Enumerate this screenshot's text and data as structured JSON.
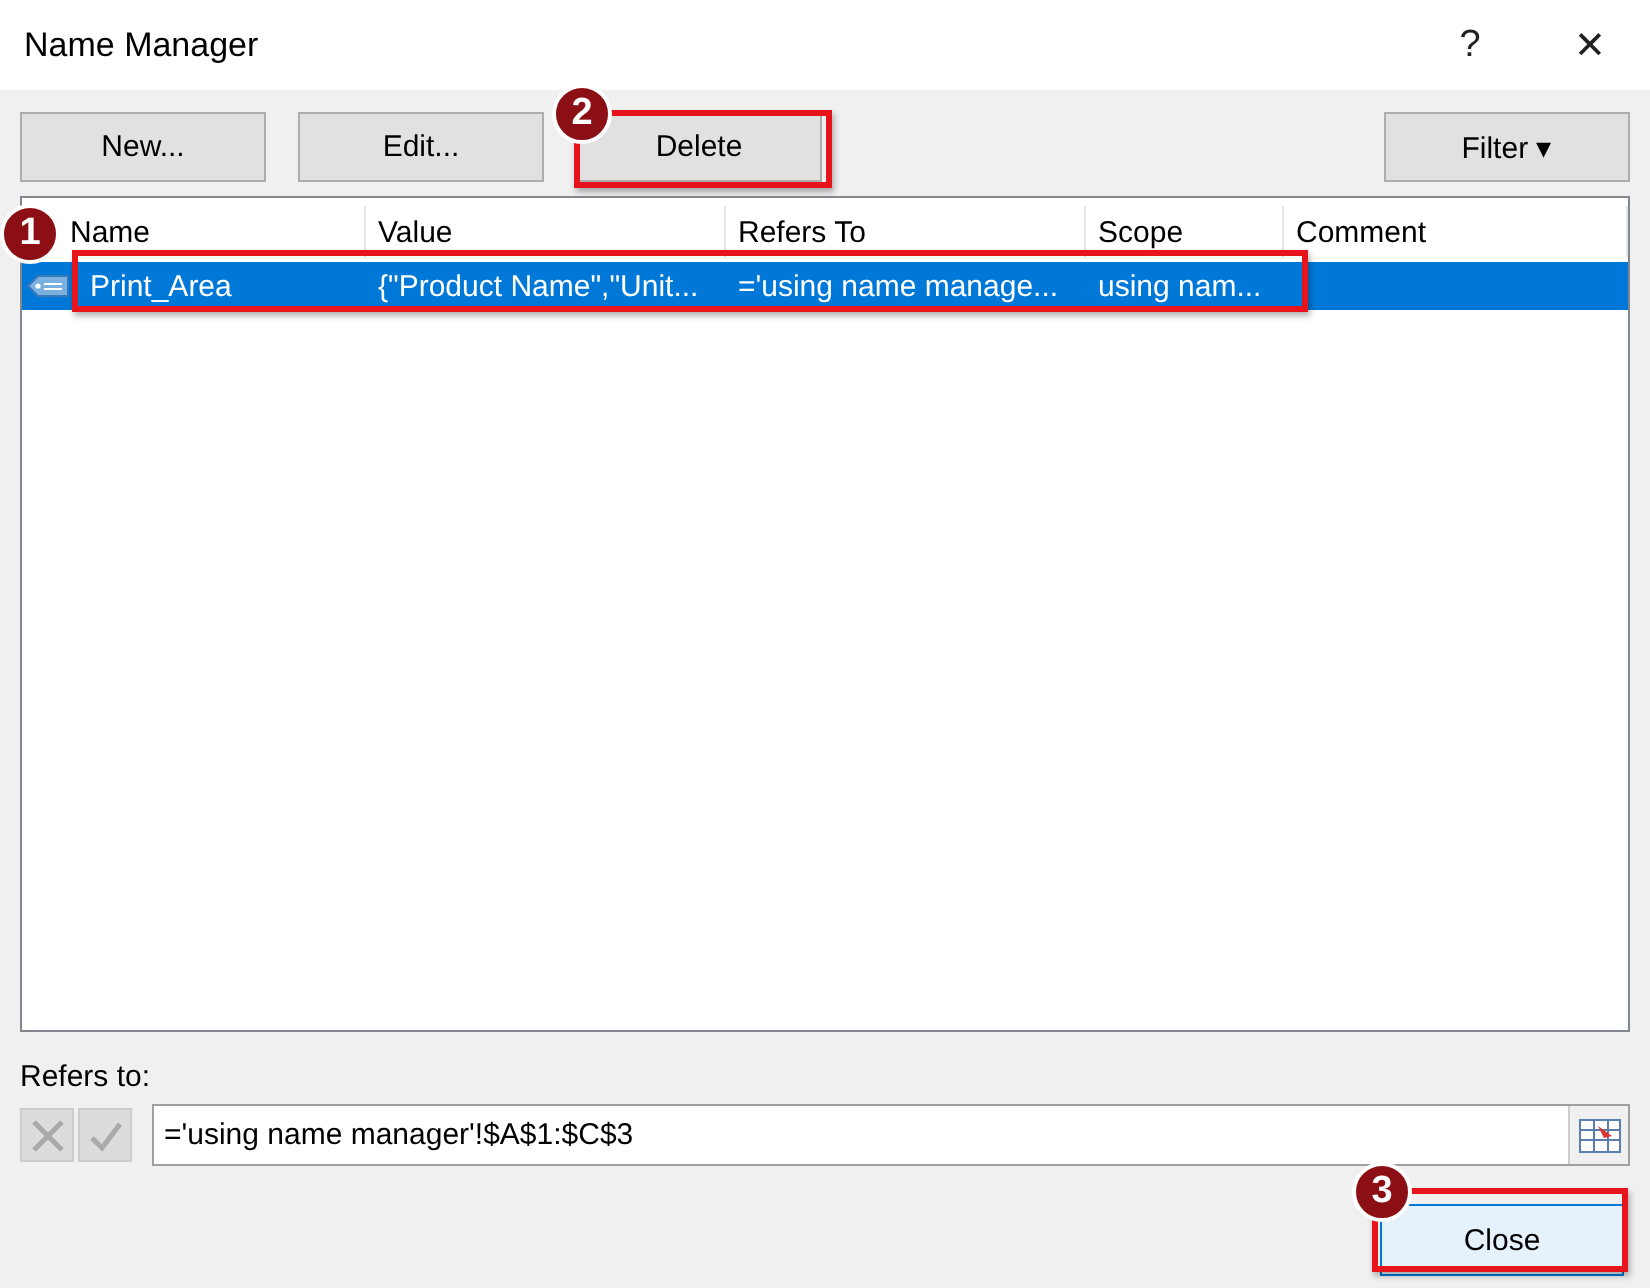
{
  "window": {
    "title": "Name Manager",
    "help": "?",
    "close": "✕"
  },
  "buttons": [
    {
      "label": "New..."
    },
    {
      "label": "Edit..."
    },
    {
      "label": "Delete"
    },
    {
      "label": "Filter",
      "caret": "▾"
    }
  ],
  "table": {
    "columns": [
      "Name",
      "Value",
      "Refers To",
      "Scope",
      "Comment"
    ],
    "rows": [
      {
        "selected": true,
        "cells": [
          "Print_Area",
          "{\"Product Name\",\"Unit...",
          "='using name manage...",
          "using nam...",
          ""
        ]
      }
    ]
  },
  "refers_to": {
    "label": "Refers to:",
    "value": "='using name manager'!$A$1:$C$3"
  },
  "close_button": {
    "label": "Close"
  },
  "annotations": [
    {
      "label": "1"
    },
    {
      "label": "2"
    },
    {
      "label": "3"
    }
  ]
}
